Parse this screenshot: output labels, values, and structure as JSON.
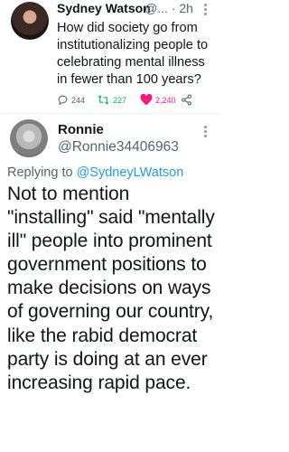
{
  "tweet": {
    "author_name": "Sydney Watson",
    "handle_time": "@... · 2h",
    "text": "How did society go from institutionalizing people to celebrating mental illness in fewer than 100 years?",
    "replies": "244",
    "retweets": "227",
    "likes": "2,240",
    "colors": {
      "retweet": "#00ba7c",
      "like": "#f91880",
      "muted": "#536471"
    }
  },
  "reply_tweet": {
    "author_name": "Ronnie",
    "handle": "@Ronnie34406963",
    "replying_to_label": "Replying to",
    "replying_to_handle": "@SydneyLWatson",
    "text": "Not to mention \"installing\" said \"mentally ill\" people into prominent government positions to make decisions on ways of governing our country, like the rabid democrat party is doing at an ever increasing rapid pace."
  }
}
